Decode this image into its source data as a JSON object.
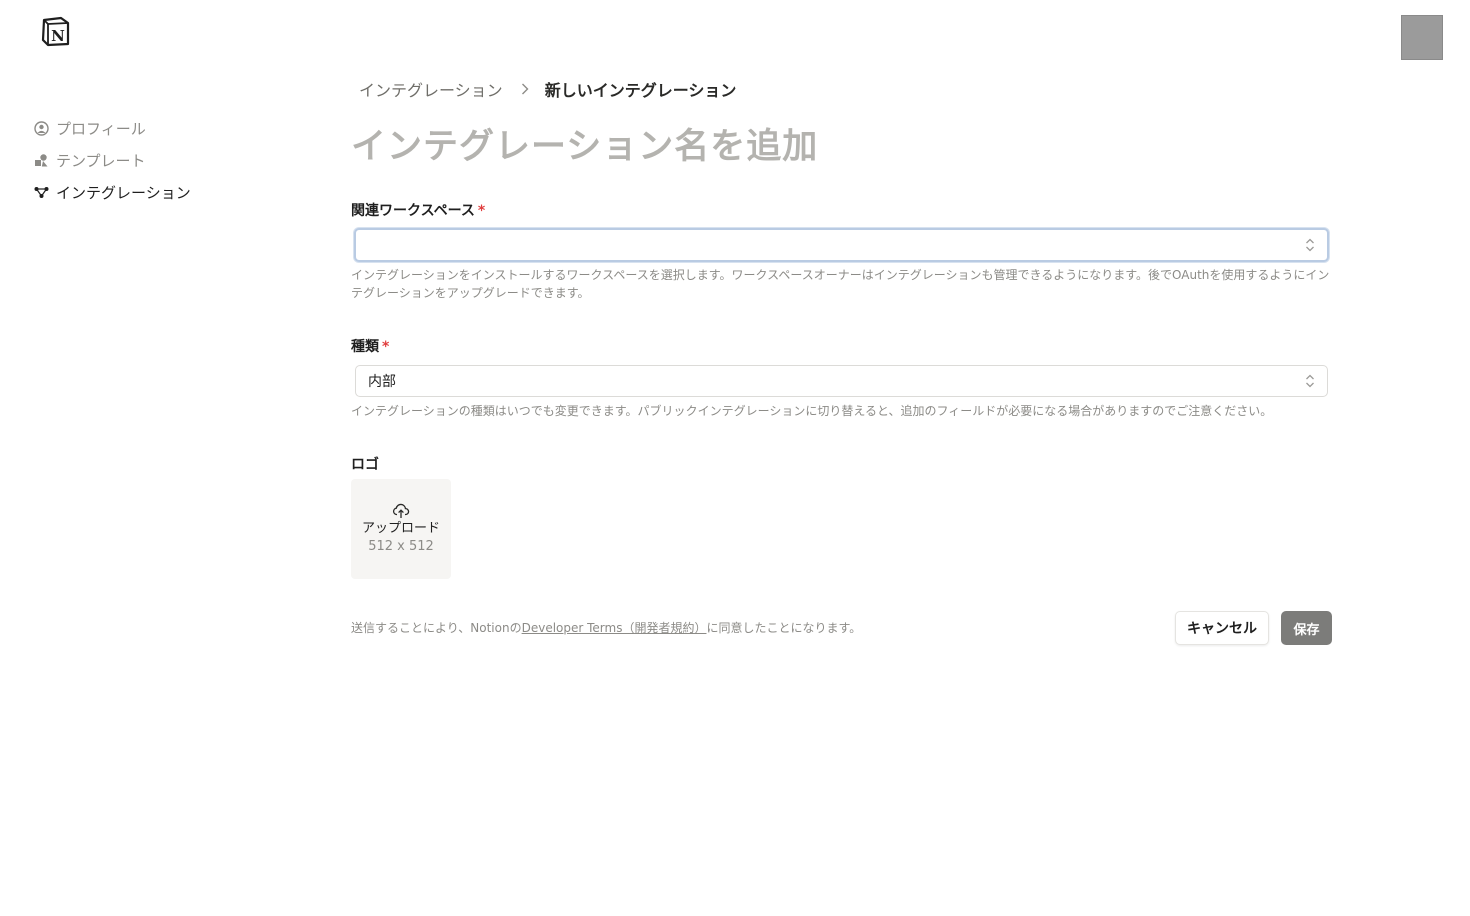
{
  "brand": {
    "logo_letter": "N"
  },
  "sidebar": {
    "items": [
      {
        "label": "プロフィール",
        "icon": "user-circle-icon",
        "active": false
      },
      {
        "label": "テンプレート",
        "icon": "shapes-icon",
        "active": false
      },
      {
        "label": "インテグレーション",
        "icon": "nodes-icon",
        "active": true
      }
    ]
  },
  "breadcrumb": {
    "parent": "インテグレーション",
    "current": "新しいインテグレーション"
  },
  "page": {
    "title_placeholder": "インテグレーション名を追加"
  },
  "form": {
    "workspace": {
      "label": "関連ワークスペース",
      "required_mark": "*",
      "value": "",
      "help": "インテグレーションをインストールするワークスペースを選択します。ワークスペースオーナーはインテグレーションも管理できるようになります。後でOAuthを使用するようにインテグレーションをアップグレードできます。"
    },
    "type": {
      "label": "種類",
      "required_mark": "*",
      "value": "内部",
      "help": "インテグレーションの種類はいつでも変更できます。パブリックインテグレーションに切り替えると、追加のフィールドが必要になる場合がありますのでご注意ください。"
    },
    "logo": {
      "label": "ロゴ",
      "upload_label": "アップロード",
      "size_hint": "512 x 512"
    }
  },
  "footer": {
    "terms_prefix": "送信することにより、Notionの",
    "terms_link": "Developer Terms（開発者規約）",
    "terms_suffix": "に同意したことになります。",
    "cancel_label": "キャンセル",
    "save_label": "保存"
  },
  "colors": {
    "required": "#e03e3e",
    "save_button": "#7c7c7a",
    "focus_ring": "#b9cbe3"
  }
}
